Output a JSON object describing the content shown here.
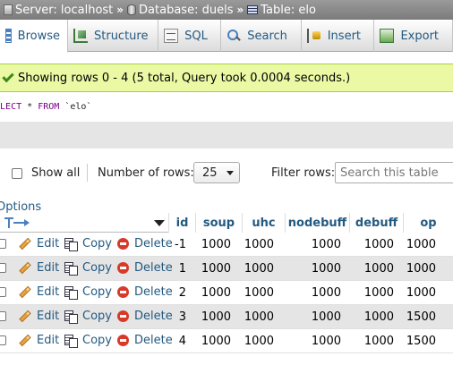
{
  "breadcrumb": {
    "server": "Server: localhost",
    "database": "Database: duels",
    "table": "Table: elo",
    "separator": "»"
  },
  "tabs": [
    {
      "label": "Browse",
      "icon": "browse-icon",
      "active": true
    },
    {
      "label": "Structure",
      "icon": "structure-icon"
    },
    {
      "label": "SQL",
      "icon": "sql-icon"
    },
    {
      "label": "Search",
      "icon": "search-icon"
    },
    {
      "label": "Insert",
      "icon": "insert-icon"
    },
    {
      "label": "Export",
      "icon": "export-icon"
    }
  ],
  "message": "Showing rows 0 - 4 (5 total, Query took 0.0004 seconds.)",
  "sql": {
    "keyword_select": "SELECT",
    "star": "*",
    "keyword_from": "FROM",
    "table": "`elo`"
  },
  "controls": {
    "show_all": "Show all",
    "number_of_rows_label": "Number of rows:",
    "rows_value": "25",
    "filter_label": "Filter rows:",
    "filter_placeholder": "Search this table"
  },
  "options_label": "Options",
  "actions": {
    "edit": "Edit",
    "copy": "Copy",
    "delete": "Delete"
  },
  "columns": [
    "id",
    "soup",
    "uhc",
    "nodebuff",
    "debuff",
    "op"
  ],
  "rows": [
    {
      "id": "-1",
      "soup": "1000",
      "uhc": "1000",
      "nodebuff": "1000",
      "debuff": "1000",
      "op": "1000"
    },
    {
      "id": "1",
      "soup": "1000",
      "uhc": "1000",
      "nodebuff": "1000",
      "debuff": "1000",
      "op": "1000"
    },
    {
      "id": "2",
      "soup": "1000",
      "uhc": "1000",
      "nodebuff": "1000",
      "debuff": "1000",
      "op": "1000"
    },
    {
      "id": "3",
      "soup": "1000",
      "uhc": "1000",
      "nodebuff": "1000",
      "debuff": "1000",
      "op": "1500"
    },
    {
      "id": "4",
      "soup": "1000",
      "uhc": "1000",
      "nodebuff": "1000",
      "debuff": "1000",
      "op": "1500"
    }
  ],
  "colors": {
    "link": "#235a81",
    "success_bg": "#ebf8a4",
    "row_alt": "#e5e5e5",
    "delete_icon": "#d83a2a"
  }
}
